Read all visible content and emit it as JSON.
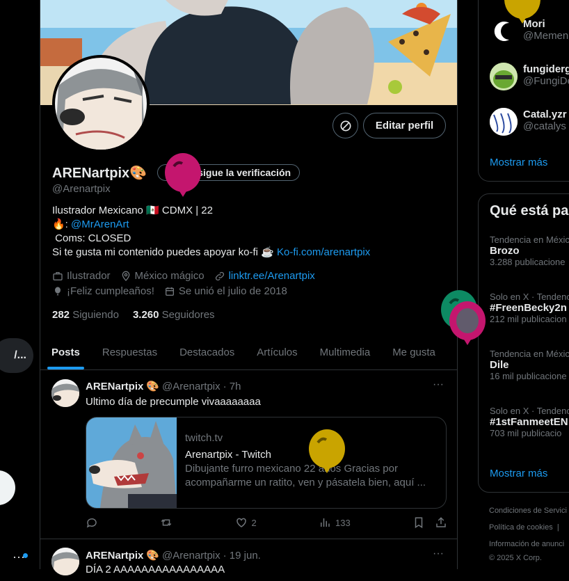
{
  "left_nav": {
    "pill_label": "/..."
  },
  "profile": {
    "display_name": "ARENartpix",
    "verify_label": "Consigue la verificación",
    "handle": "@Arenartpix",
    "edit_label": "Editar perfil",
    "bio": {
      "line1": "Ilustrador Mexicano 🇲🇽 CDMX | 22",
      "line2_prefix": "🔥:",
      "line2_link": "@MrArenArt",
      "line3": "Coms: CLOSED",
      "line4_text": "Si te gusta mi contenido puedes apoyar ko-fi ☕",
      "line4_link": "Ko-fi.com/arenartpix"
    },
    "meta": {
      "job": "Ilustrador",
      "location": "México mágico",
      "website": "linktr.ee/Arenartpix",
      "birthday": "¡Feliz cumpleaños!",
      "joined": "Se unió el julio de 2018"
    },
    "following_count": "282",
    "following_label": "Siguiendo",
    "followers_count": "3.260",
    "followers_label": "Seguidores"
  },
  "tabs": [
    "Posts",
    "Respuestas",
    "Destacados",
    "Artículos",
    "Multimedia",
    "Me gusta"
  ],
  "posts": [
    {
      "name": "ARENartpix",
      "handle": "@Arenartpix",
      "time": "· 7h",
      "text": "Ultimo día de precumple vivaaaaaaaa",
      "card": {
        "domain": "twitch.tv",
        "title": "Arenartpix - Twitch",
        "desc": "Dibujante furro mexicano 22 años Gracias por acompañarme un ratito, ven y pásatela bien, aquí ..."
      },
      "likes": "2",
      "views": "133"
    },
    {
      "name": "ARENartpix",
      "handle": "@Arenartpix",
      "time": "· 19 jun.",
      "text": "DÍA 2 AAAAAAAAAAAAAAAA"
    }
  ],
  "who_to_follow": [
    {
      "name": "Mori",
      "handle": "@Memen"
    },
    {
      "name": "fungiderg",
      "handle": "@FungiDe"
    },
    {
      "name": "Catal.yzr",
      "handle": "@catalys"
    }
  ],
  "show_more": "Mostrar más",
  "trends_title": "Qué está pa",
  "trends": [
    {
      "category": "Tendencia en México",
      "name": "Brozo",
      "count": "3.288 publicacione"
    },
    {
      "category": "Solo en X · Tendenc",
      "name": "#FreenBecky2n",
      "count": "212 mil publicacion"
    },
    {
      "category": "Tendencia en Méxic",
      "name": "Dile",
      "count": "16 mil publicacione"
    },
    {
      "category": "Solo en X · Tendenc",
      "name": "#1stFanmeetEN",
      "count": "703 mil publicacio"
    }
  ],
  "footer": {
    "terms": "Condiciones de Servici",
    "cookies": "Política de cookies",
    "ads": "Información de anunci",
    "copyright": "© 2025 X Corp."
  },
  "colors": {
    "accent": "#1d9bf0",
    "border": "#2f3336",
    "muted": "#71767b",
    "balloon_pink": "#c4166e",
    "balloon_green": "#0d8a63",
    "balloon_gold": "#c9a400"
  }
}
